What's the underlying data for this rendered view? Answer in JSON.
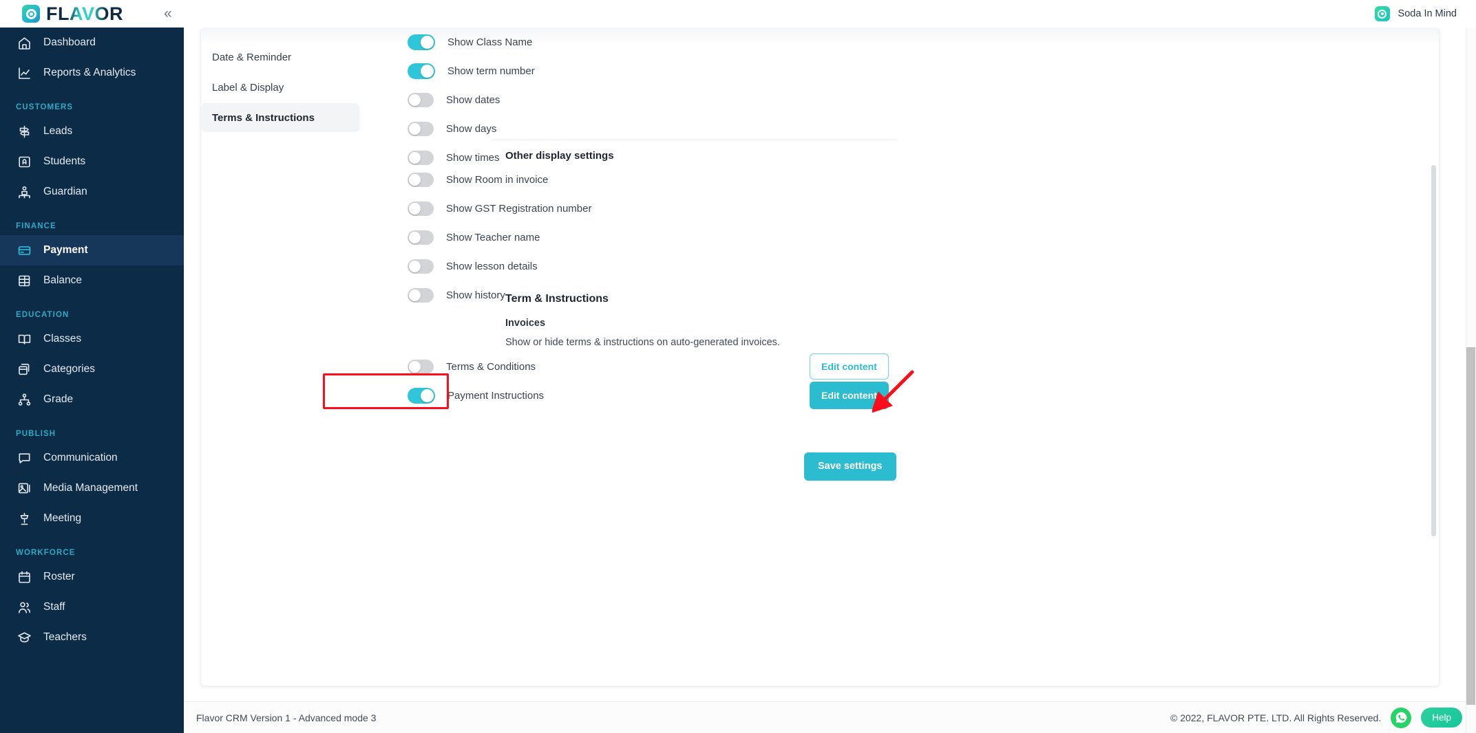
{
  "topbar": {
    "brand_word": "FLAVOR",
    "brand_icon": "flavor-logo-icon",
    "collapse_icon": "«",
    "account_name": "Soda In Mind",
    "account_icon": "soda-in-mind-logo-icon"
  },
  "sidebar": {
    "items": [
      {
        "type": "item",
        "label": "Dashboard",
        "icon": "home-icon",
        "active": false
      },
      {
        "type": "item",
        "label": "Reports & Analytics",
        "icon": "chart-line-icon",
        "active": false
      },
      {
        "type": "group",
        "label": "CUSTOMERS"
      },
      {
        "type": "item",
        "label": "Leads",
        "icon": "signpost-icon",
        "active": false
      },
      {
        "type": "item",
        "label": "Students",
        "icon": "id-card-icon",
        "active": false
      },
      {
        "type": "item",
        "label": "Guardian",
        "icon": "guardian-icon",
        "active": false
      },
      {
        "type": "group",
        "label": "FINANCE"
      },
      {
        "type": "item",
        "label": "Payment",
        "icon": "credit-card-icon",
        "active": true
      },
      {
        "type": "item",
        "label": "Balance",
        "icon": "ledger-icon",
        "active": false
      },
      {
        "type": "group",
        "label": "EDUCATION"
      },
      {
        "type": "item",
        "label": "Classes",
        "icon": "book-open-icon",
        "active": false
      },
      {
        "type": "item",
        "label": "Categories",
        "icon": "boxes-icon",
        "active": false
      },
      {
        "type": "item",
        "label": "Grade",
        "icon": "hierarchy-icon",
        "active": false
      },
      {
        "type": "group",
        "label": "PUBLISH"
      },
      {
        "type": "item",
        "label": "Communication",
        "icon": "chat-bubble-icon",
        "active": false
      },
      {
        "type": "item",
        "label": "Media Management",
        "icon": "image-icon",
        "active": false
      },
      {
        "type": "item",
        "label": "Meeting",
        "icon": "podium-icon",
        "active": false
      },
      {
        "type": "group",
        "label": "WORKFORCE"
      },
      {
        "type": "item",
        "label": "Roster",
        "icon": "calendar-icon",
        "active": false
      },
      {
        "type": "item",
        "label": "Staff",
        "icon": "users-icon",
        "active": false
      },
      {
        "type": "item",
        "label": "Teachers",
        "icon": "graduation-cap-icon",
        "active": false
      }
    ]
  },
  "subnav": {
    "items": [
      {
        "label": "Date & Reminder",
        "active": false
      },
      {
        "label": "Label & Display",
        "active": false
      },
      {
        "label": "Terms & Instructions",
        "active": true
      }
    ]
  },
  "settings": {
    "display_toggles": [
      {
        "label": "Show Class Name",
        "on": true
      },
      {
        "label": "Show term number",
        "on": true
      },
      {
        "label": "Show dates",
        "on": false
      },
      {
        "label": "Show days",
        "on": false
      },
      {
        "label": "Show times",
        "on": false
      }
    ],
    "other_display_heading": "Other display settings",
    "other_toggles": [
      {
        "label": "Show Room in invoice",
        "on": false
      },
      {
        "label": "Show GST Registration number",
        "on": false
      },
      {
        "label": "Show Teacher name",
        "on": false
      },
      {
        "label": "Show lesson details",
        "on": false
      },
      {
        "label": "Show history",
        "on": false
      }
    ],
    "terms_heading": "Term & Instructions",
    "invoices_heading": "Invoices",
    "invoices_helper": "Show or hide terms & instructions on auto-generated invoices.",
    "terms_toggles": [
      {
        "label": "Terms & Conditions",
        "on": false,
        "button": "Edit content",
        "button_style": "outline",
        "highlighted": false
      },
      {
        "label": "Payment Instructions",
        "on": true,
        "button": "Edit content",
        "button_style": "solid",
        "highlighted": true
      }
    ],
    "save_label": "Save settings"
  },
  "footer": {
    "version": "Flavor CRM Version 1 - Advanced mode 3",
    "copyright": "© 2022, FLAVOR PTE. LTD. All Rights Reserved.",
    "whatsapp_icon": "whatsapp-icon",
    "help_label": "Help"
  },
  "colors": {
    "accent": "#2bbcd0",
    "sidebar": "#0c2b47",
    "sidebar_active": "#17375a",
    "group_label": "#2ea9c4",
    "annotation": "#fc0d1b",
    "whatsapp": "#25d366"
  }
}
